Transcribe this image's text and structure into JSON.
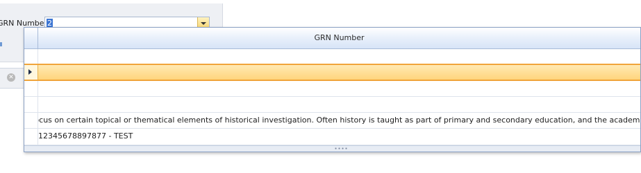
{
  "form": {
    "grn_label": "GRN Number",
    "grn_value": "2"
  },
  "grid": {
    "column_header": "GRN Number",
    "selected_row_index": 1,
    "rows": [
      "",
      "",
      "",
      "ı focus on certain topical or thematical elements of historical investigation. Often history is taught as part of primary and secondary education, and the academic study of histo",
      "12345678897877 - TEST"
    ]
  },
  "icons": {
    "combo_button": "chevron-down-icon",
    "row_indicator": "row-pointer-icon",
    "clear": "clear-icon",
    "resize": "resize-grip-icon"
  },
  "colors": {
    "selection": "#ffd57d",
    "selection_border": "#f0a43a",
    "header": "#d7e4f7",
    "text_highlight": "#3a74d3"
  }
}
